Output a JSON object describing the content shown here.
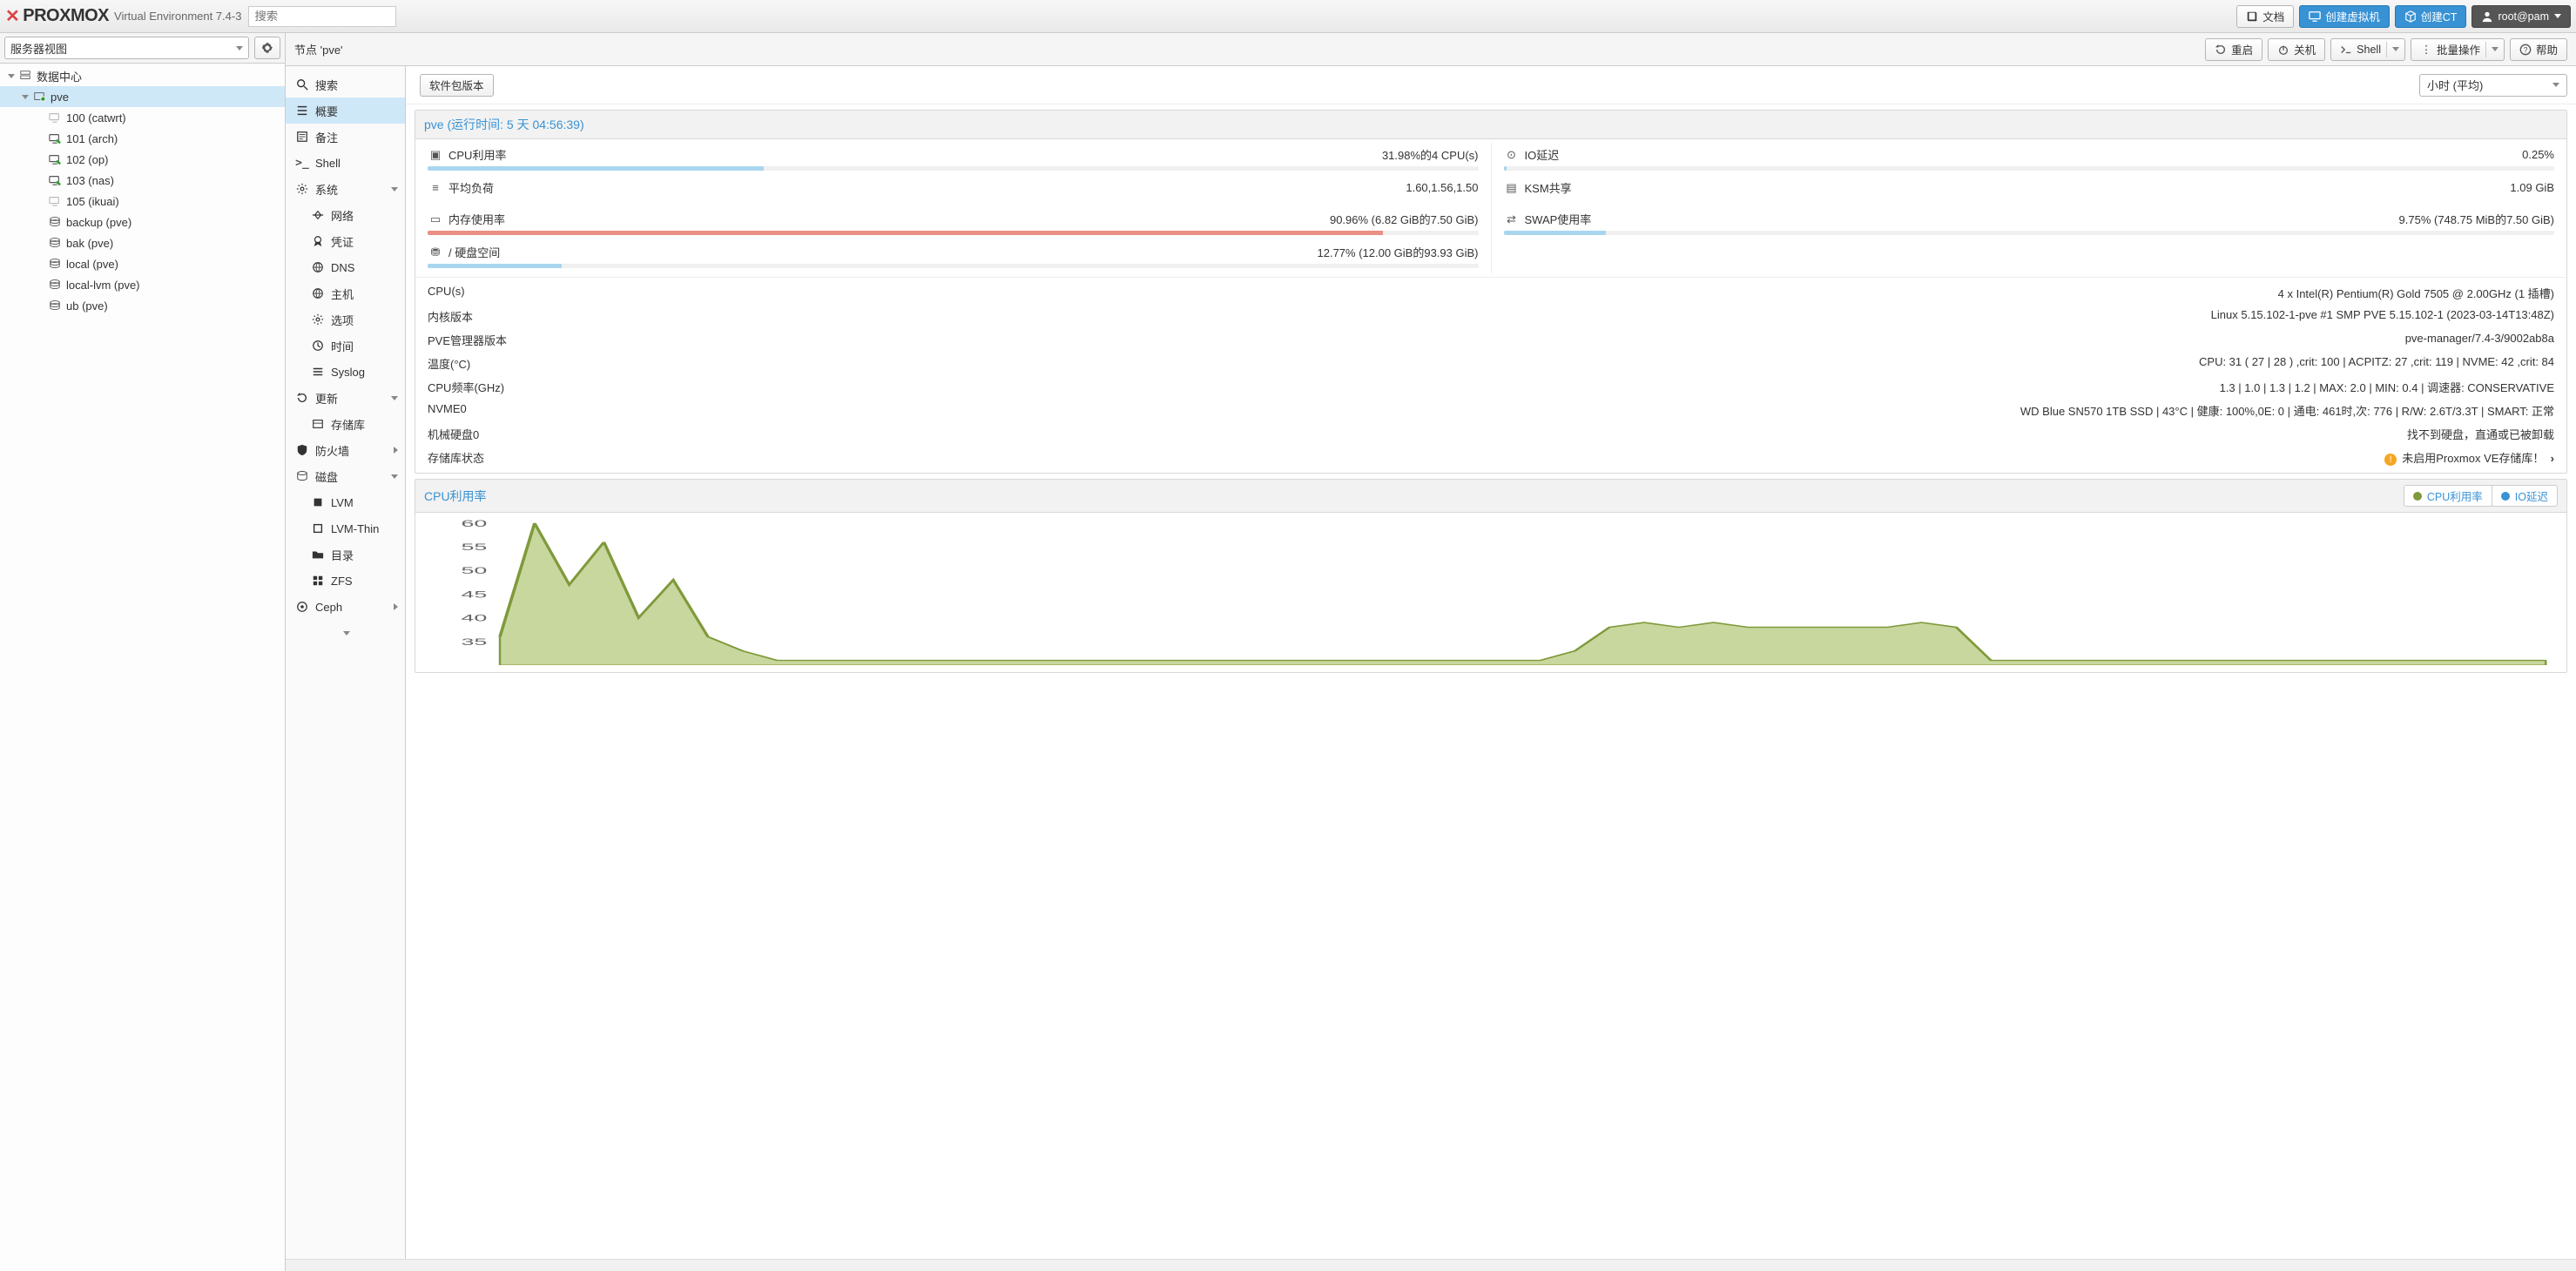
{
  "header": {
    "product": "PROXMOX",
    "subtitle": "Virtual Environment 7.4-3",
    "search_placeholder": "搜索",
    "docs": "文档",
    "create_vm": "创建虚拟机",
    "create_ct": "创建CT",
    "user": "root@pam"
  },
  "view_selector": "服务器视图",
  "tree": {
    "datacenter": "数据中心",
    "node": "pve",
    "items": [
      {
        "label": "100 (catwrt)",
        "status": "off"
      },
      {
        "label": "101 (arch)",
        "status": "on"
      },
      {
        "label": "102 (op)",
        "status": "on"
      },
      {
        "label": "103 (nas)",
        "status": "on"
      },
      {
        "label": "105 (ikuai)",
        "status": "off"
      },
      {
        "label": "backup (pve)",
        "status": "storage"
      },
      {
        "label": "bak (pve)",
        "status": "storage"
      },
      {
        "label": "local (pve)",
        "status": "storage"
      },
      {
        "label": "local-lvm (pve)",
        "status": "storage"
      },
      {
        "label": "ub (pve)",
        "status": "storage"
      }
    ]
  },
  "crumb": {
    "title": "节点 'pve'",
    "btn_reboot": "重启",
    "btn_shutdown": "关机",
    "btn_shell": "Shell",
    "btn_bulk": "批量操作",
    "btn_help": "帮助"
  },
  "innernav": [
    {
      "label": "搜索",
      "icon": "search"
    },
    {
      "label": "概要",
      "icon": "list",
      "active": true
    },
    {
      "label": "备注",
      "icon": "note"
    },
    {
      "label": "Shell",
      "icon": "shell"
    },
    {
      "label": "系统",
      "icon": "gear",
      "expandable": true
    },
    {
      "label": "网络",
      "icon": "net",
      "sub": true
    },
    {
      "label": "凭证",
      "icon": "cert",
      "sub": true
    },
    {
      "label": "DNS",
      "icon": "globe",
      "sub": true
    },
    {
      "label": "主机",
      "icon": "globe",
      "sub": true
    },
    {
      "label": "选项",
      "icon": "cog",
      "sub": true
    },
    {
      "label": "时间",
      "icon": "clock",
      "sub": true
    },
    {
      "label": "Syslog",
      "icon": "log",
      "sub": true
    },
    {
      "label": "更新",
      "icon": "refresh",
      "expandable": true
    },
    {
      "label": "存储库",
      "icon": "repo",
      "sub": true
    },
    {
      "label": "防火墙",
      "icon": "shield",
      "expandable": true,
      "chev": "right"
    },
    {
      "label": "磁盘",
      "icon": "disk",
      "expandable": true
    },
    {
      "label": "LVM",
      "icon": "sq",
      "sub": true
    },
    {
      "label": "LVM-Thin",
      "icon": "sqo",
      "sub": true
    },
    {
      "label": "目录",
      "icon": "folder",
      "sub": true
    },
    {
      "label": "ZFS",
      "icon": "grid",
      "sub": true
    },
    {
      "label": "Ceph",
      "icon": "ceph",
      "expandable": true,
      "chev": "right"
    }
  ],
  "toolbar2": {
    "pkg_versions": "软件包版本",
    "time_range": "小时 (平均)"
  },
  "summary": {
    "title": "pve (运行时间: 5 天 04:56:39)",
    "left": [
      {
        "label": "CPU利用率",
        "value": "31.98%的4 CPU(s)",
        "bar": 31.98
      },
      {
        "label": "平均负荷",
        "value": "1.60,1.56,1.50"
      },
      {
        "label": "内存使用率",
        "value": "90.96% (6.82 GiB的7.50 GiB)",
        "bar": 90.96,
        "red": true
      },
      {
        "label": "/ 硬盘空间",
        "value": "12.77% (12.00 GiB的93.93 GiB)",
        "bar": 12.77
      }
    ],
    "right": [
      {
        "label": "IO延迟",
        "value": "0.25%",
        "bar": 0.25
      },
      {
        "label": "KSM共享",
        "value": "1.09 GiB"
      },
      {
        "label": "SWAP使用率",
        "value": "9.75% (748.75 MiB的7.50 GiB)",
        "bar": 9.75
      }
    ],
    "info": [
      {
        "k": "CPU(s)",
        "v": "4 x Intel(R) Pentium(R) Gold 7505 @ 2.00GHz (1 插槽)"
      },
      {
        "k": "内核版本",
        "v": "Linux 5.15.102-1-pve #1 SMP PVE 5.15.102-1 (2023-03-14T13:48Z)"
      },
      {
        "k": "PVE管理器版本",
        "v": "pve-manager/7.4-3/9002ab8a"
      },
      {
        "k": "温度(°C)",
        "v": "CPU: 31 ( 27 | 28 ) ,crit: 100 | ACPITZ: 27 ,crit: 119 | NVME: 42 ,crit: 84"
      },
      {
        "k": "CPU频率(GHz)",
        "v": "1.3 | 1.0 | 1.3 | 1.2 | MAX: 2.0 | MIN: 0.4 | 调速器: CONSERVATIVE"
      },
      {
        "k": "NVME0",
        "v": "WD Blue SN570 1TB SSD | 43°C | 健康: 100%,0E: 0 | 通电: 461时,次: 776 | R/W: 2.6T/3.3T | SMART: 正常"
      },
      {
        "k": "机械硬盘0",
        "v": "找不到硬盘，直通或已被卸载"
      },
      {
        "k": "存储库状态",
        "v": "未启用Proxmox VE存储库！",
        "warn": true,
        "arrow": true
      }
    ]
  },
  "chart": {
    "title": "CPU利用率",
    "legend": [
      {
        "label": "CPU利用率",
        "color": "#7f9a3b"
      },
      {
        "label": "IO延迟",
        "color": "#3892d4"
      }
    ]
  },
  "chart_data": {
    "type": "area",
    "ylabel": "",
    "ylim": [
      30,
      60
    ],
    "yticks": [
      60,
      55,
      50,
      45,
      40,
      35
    ],
    "series": [
      {
        "name": "CPU利用率",
        "color": "#b6c97e",
        "values": [
          36,
          60,
          47,
          56,
          40,
          48,
          36,
          33,
          31,
          31,
          31,
          31,
          31,
          31,
          31,
          31,
          31,
          31,
          31,
          31,
          31,
          31,
          31,
          31,
          31,
          31,
          31,
          31,
          31,
          31,
          31,
          33,
          38,
          39,
          38,
          39,
          38,
          38,
          38,
          38,
          38,
          39,
          38,
          31,
          31,
          31,
          31,
          31,
          31,
          31,
          31,
          31,
          31,
          31,
          31,
          31,
          31,
          31,
          31,
          31
        ]
      }
    ]
  }
}
